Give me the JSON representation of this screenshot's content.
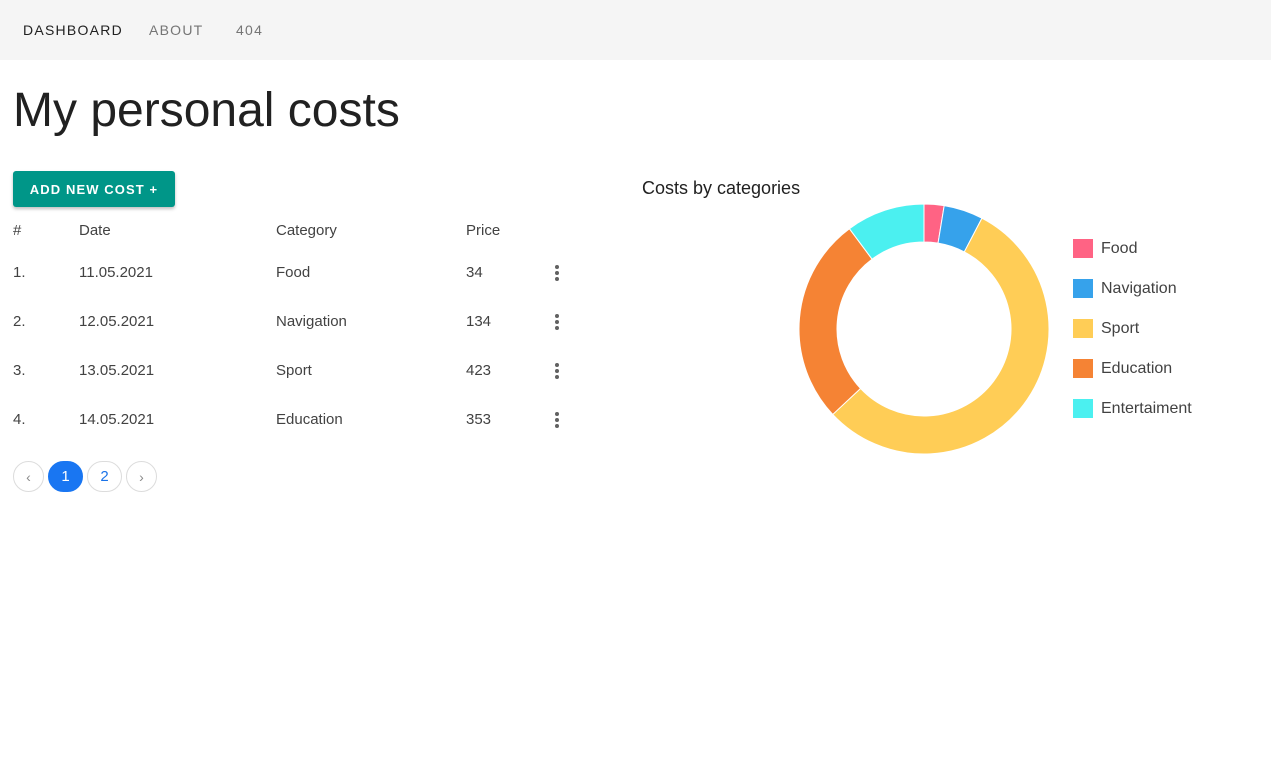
{
  "nav": {
    "items": [
      {
        "label": "DASHBOARD",
        "active": true
      },
      {
        "label": "ABOUT",
        "active": false
      },
      {
        "label": "404",
        "active": false
      }
    ]
  },
  "page": {
    "title": "My personal costs",
    "add_button_label": "ADD NEW COST +"
  },
  "table": {
    "headers": [
      "#",
      "Date",
      "Category",
      "Price"
    ],
    "rows": [
      {
        "num": "1.",
        "date": "11.05.2021",
        "category": "Food",
        "price": "34"
      },
      {
        "num": "2.",
        "date": "12.05.2021",
        "category": "Navigation",
        "price": "134"
      },
      {
        "num": "3.",
        "date": "13.05.2021",
        "category": "Sport",
        "price": "423"
      },
      {
        "num": "4.",
        "date": "14.05.2021",
        "category": "Education",
        "price": "353"
      }
    ],
    "row_menu_icon": "more-vert-icon"
  },
  "pagination": {
    "prev": "‹",
    "pages": [
      "1",
      "2"
    ],
    "current": "1",
    "next": "›"
  },
  "chart_data": {
    "type": "pie",
    "style": "doughnut",
    "title": "Costs by categories",
    "categories": [
      "Food",
      "Navigation",
      "Sport",
      "Education",
      "Entertaiment"
    ],
    "values": [
      34,
      67,
      729,
      353,
      134
    ],
    "colors": [
      "#ff6384",
      "#36a2eb",
      "#ffcd56",
      "#f58334",
      "#4bf0f0"
    ],
    "legend_position": "right"
  }
}
